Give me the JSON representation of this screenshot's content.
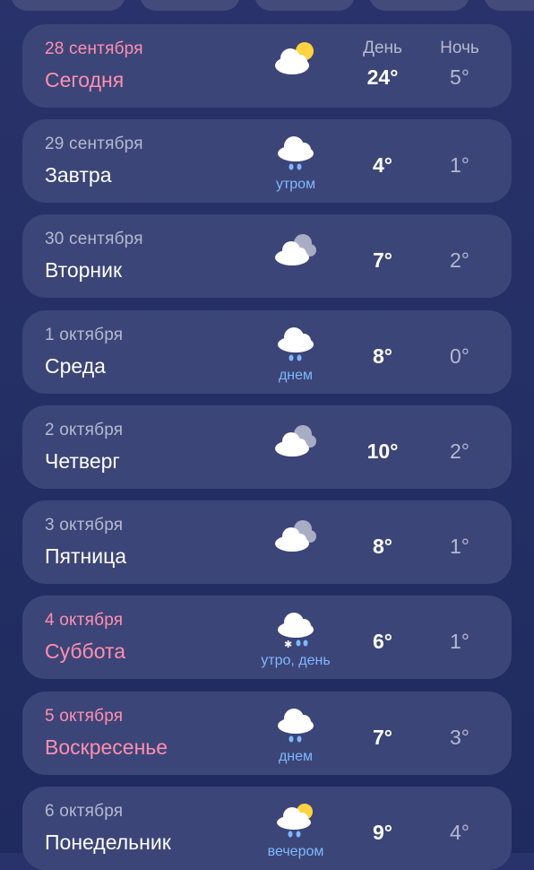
{
  "header": {
    "day_label": "День",
    "night_label": "Ночь"
  },
  "colors": {
    "weekend": "#ff8fb1",
    "note": "#7fb8ff",
    "card": "#3c4577"
  },
  "days": [
    {
      "date": "28 сентября",
      "name": "Сегодня",
      "icon": "sun-cloud-icon",
      "note": "",
      "day": "24°",
      "night": "5°",
      "highlight": true
    },
    {
      "date": "29 сентября",
      "name": "Завтра",
      "icon": "cloud-rain-icon",
      "note": "утром",
      "day": "4°",
      "night": "1°",
      "highlight": false
    },
    {
      "date": "30 сентября",
      "name": "Вторник",
      "icon": "overcast-icon",
      "note": "",
      "day": "7°",
      "night": "2°",
      "highlight": false
    },
    {
      "date": "1 октября",
      "name": "Среда",
      "icon": "cloud-rain-icon",
      "note": "днем",
      "day": "8°",
      "night": "0°",
      "highlight": false
    },
    {
      "date": "2 октября",
      "name": "Четверг",
      "icon": "overcast-icon",
      "note": "",
      "day": "10°",
      "night": "2°",
      "highlight": false
    },
    {
      "date": "3 октября",
      "name": "Пятница",
      "icon": "overcast-icon",
      "note": "",
      "day": "8°",
      "night": "1°",
      "highlight": false
    },
    {
      "date": "4 октября",
      "name": "Суббота",
      "icon": "cloud-sleet-icon",
      "note": "утро, день",
      "day": "6°",
      "night": "1°",
      "highlight": true
    },
    {
      "date": "5 октября",
      "name": "Воскресенье",
      "icon": "cloud-rain-icon",
      "note": "днем",
      "day": "7°",
      "night": "3°",
      "highlight": true
    },
    {
      "date": "6 октября",
      "name": "Понедельник",
      "icon": "sun-cloud-rain-icon",
      "note": "вечером",
      "day": "9°",
      "night": "4°",
      "highlight": false
    }
  ]
}
